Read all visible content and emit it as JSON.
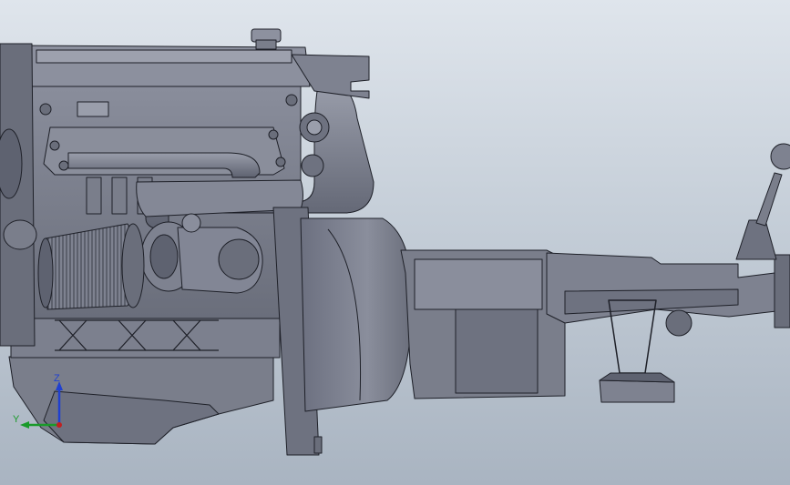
{
  "viewport": {
    "background_top": "#dfe5ec",
    "background_bottom": "#a9b4c1",
    "model_color": "#7c808f",
    "model_edge_color": "#1e2028",
    "model_shade_color": "#5c606d",
    "model_highlight_color": "#9da1ae"
  },
  "triad": {
    "z_label": "Z",
    "y_label": "Y",
    "z_color": "#2040d0",
    "y_color": "#1a9a2a",
    "x_color": "#c02020"
  }
}
